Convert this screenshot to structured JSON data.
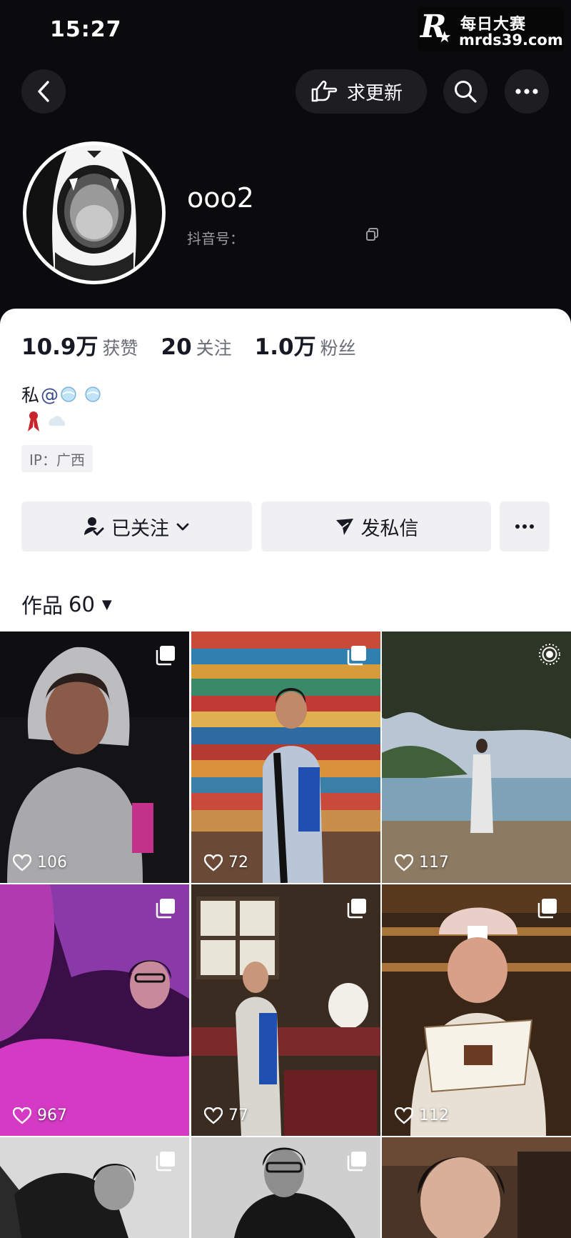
{
  "status_bar": {
    "time": "15:27"
  },
  "watermark": {
    "logo": "R",
    "title": "每日大赛",
    "url": "mrds39.com"
  },
  "nav": {
    "update_label": "求更新"
  },
  "profile": {
    "username": "ooo2",
    "douyin_id_label": "抖音号："
  },
  "stats": [
    {
      "num": "10.9万",
      "label": "获赞"
    },
    {
      "num": "20",
      "label": "关注"
    },
    {
      "num": "1.0万",
      "label": "粉丝"
    }
  ],
  "bio": {
    "line1_prefix": "私",
    "line1_at": "@"
  },
  "ip": "IP：广西",
  "actions": {
    "follow_label": "已关注",
    "message_label": "发私信"
  },
  "works": {
    "tab_label": "作品",
    "count": "60"
  },
  "grid": [
    {
      "likes": "106",
      "badge": "multi-image-icon"
    },
    {
      "likes": "72",
      "badge": "multi-image-icon"
    },
    {
      "likes": "117",
      "badge": "live-photo-icon"
    },
    {
      "likes": "967",
      "badge": "multi-image-icon"
    },
    {
      "likes": "77",
      "badge": "multi-image-icon"
    },
    {
      "likes": "112",
      "badge": "multi-image-icon"
    },
    {
      "likes": "",
      "badge": "multi-image-icon"
    },
    {
      "likes": "",
      "badge": "multi-image-icon"
    },
    {
      "likes": "",
      "badge": ""
    }
  ],
  "colors": {
    "background": "#0b0b0d",
    "card": "#ffffff",
    "button": "#f0f0f2",
    "mention": "#3a4e8c"
  }
}
